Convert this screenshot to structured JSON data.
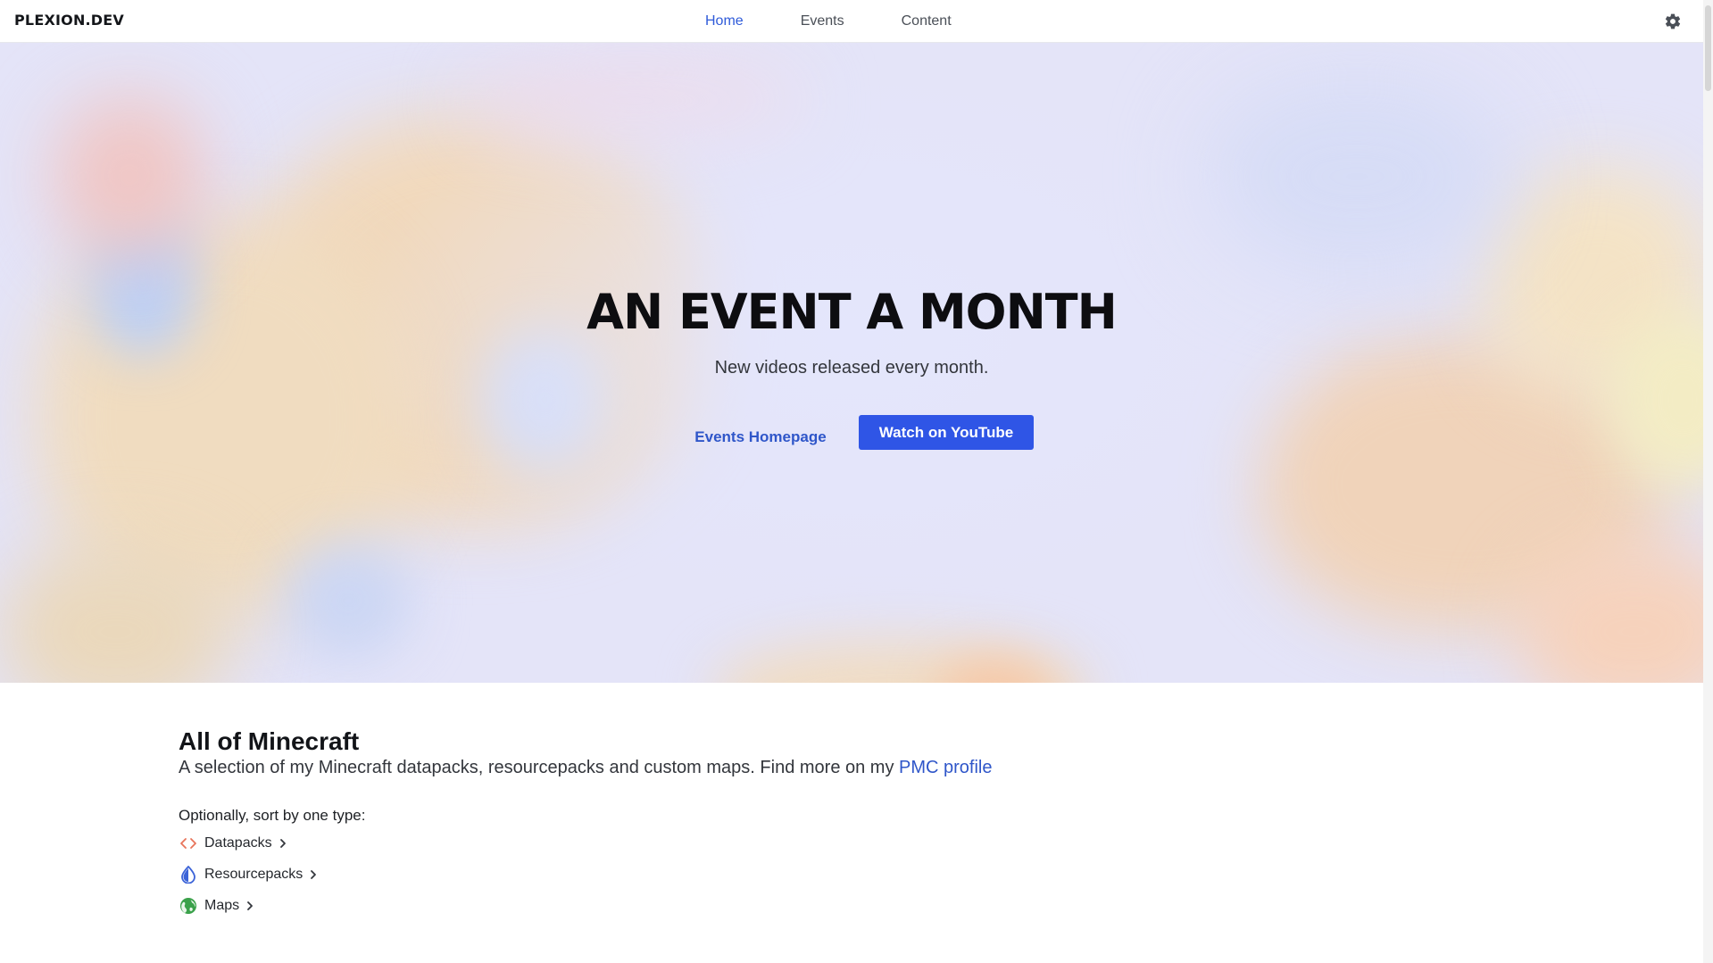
{
  "brand": "PLEXION.DEV",
  "nav": {
    "items": [
      {
        "label": "Home",
        "active": true
      },
      {
        "label": "Events",
        "active": false
      },
      {
        "label": "Content",
        "active": false
      }
    ],
    "settings_icon": "gear-icon"
  },
  "hero": {
    "title": "AN EVENT A MONTH",
    "subtitle": "New videos released every month.",
    "secondary_action": "Events Homepage",
    "primary_action": "Watch on YouTube"
  },
  "section": {
    "title": "All of Minecraft",
    "description": "A selection of my Minecraft datapacks, resourcepacks and custom maps. Find more on my ",
    "description_link": "PMC profile",
    "sort_label": "Optionally, sort by one type:",
    "types": [
      {
        "label": "Datapacks",
        "icon": "code-brackets-icon"
      },
      {
        "label": "Resourcepacks",
        "icon": "drop-icon"
      },
      {
        "label": "Maps",
        "icon": "globe-icon"
      }
    ]
  },
  "colors": {
    "accent": "#2f55e6",
    "link": "#2f56c9",
    "datapack_icon": "#e8745a",
    "resourcepack_icon": "#3b63d8",
    "map_icon": "#3aa14a"
  }
}
